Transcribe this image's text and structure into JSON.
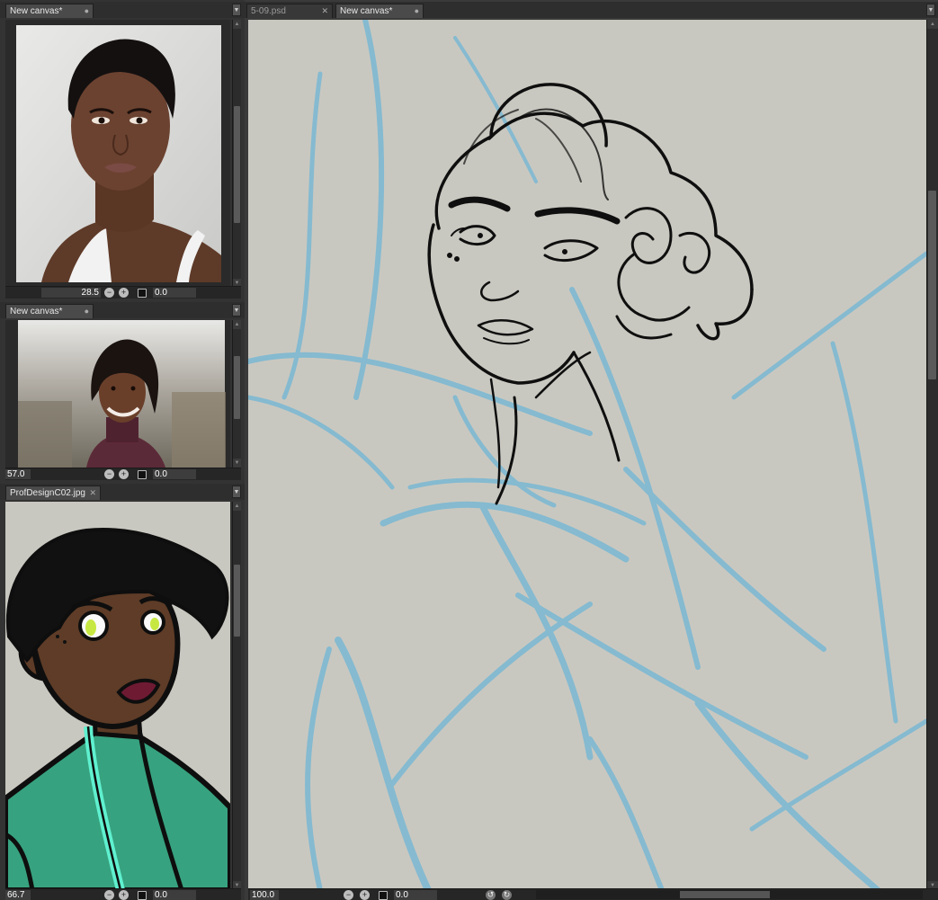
{
  "left_panels": [
    {
      "tab_title": "New canvas*",
      "zoom": "28.5",
      "angle": "0.0"
    },
    {
      "tab_title": "New canvas*",
      "zoom": "57.0",
      "angle": "0.0"
    },
    {
      "tab_title": "ProfDesignC02.jpg",
      "zoom": "66.7",
      "angle": "0.0"
    }
  ],
  "main": {
    "tabs": [
      {
        "label": "5-09.psd",
        "active": false
      },
      {
        "label": "New canvas*",
        "active": true
      }
    ],
    "zoom": "100.0",
    "angle": "0.0"
  },
  "icons": {
    "zoom_out": "zoom-out-icon",
    "zoom_in": "zoom-in-icon",
    "fit": "fit-window-icon",
    "rotate_left": "rotate-left-icon",
    "rotate_right": "rotate-right-icon",
    "tab_close": "close-icon",
    "tab_dot": "unsaved-dot-icon",
    "panel_menu": "panel-menu-icon"
  },
  "colors": {
    "sketch_blue": "#6fb6d6",
    "canvas_bg": "#c9c8c0",
    "ui_dark": "#2e2e2e"
  }
}
